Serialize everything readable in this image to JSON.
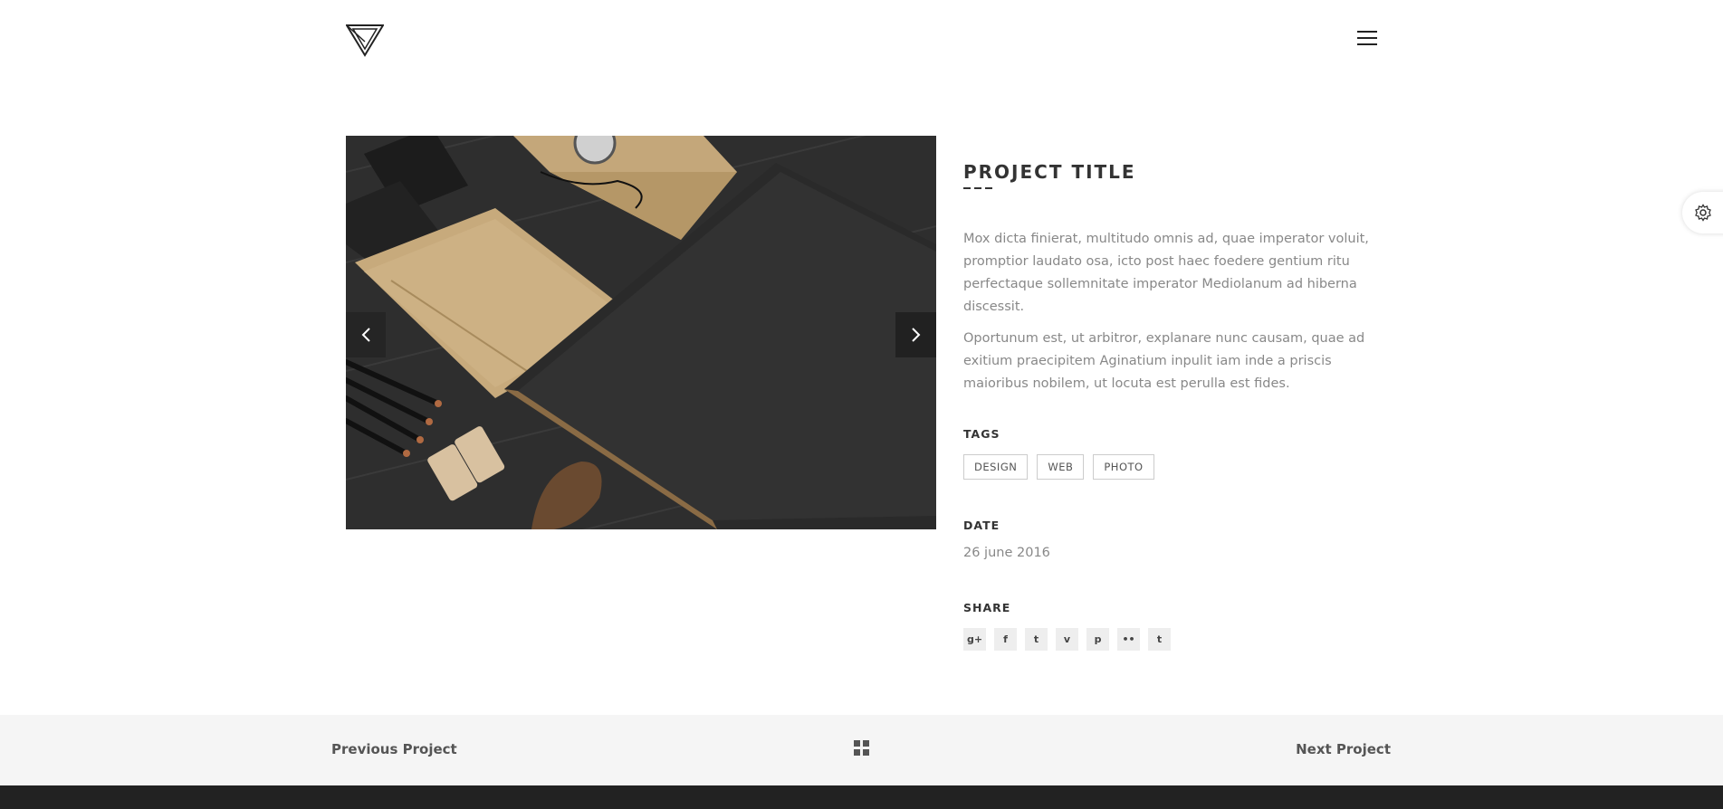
{
  "header": {
    "logo_icon": "triangle-logo",
    "menu_icon": "hamburger-menu-icon"
  },
  "slider": {
    "prev_icon": "chevron-left-icon",
    "next_icon": "chevron-right-icon"
  },
  "project": {
    "title": "PROJECT TITLE",
    "paragraph1": "Mox dicta finierat, multitudo omnis ad, quae imperator voluit, promptior laudato osa, icto post haec foedere gentium ritu perfectaque sollemnitate imperator Mediolanum ad hiberna discessit.",
    "paragraph2": "Oportunum est, ut arbitror, explanare nunc causam, quae ad exitium praecipitem Aginatium inpulit iam inde a priscis maioribus nobilem, ut locuta est perulla est fides.",
    "tags_label": "TAGS",
    "tags": [
      "DESIGN",
      "WEB",
      "PHOTO"
    ],
    "date_label": "DATE",
    "date": "26 june 2016",
    "share_label": "SHARE",
    "share_icons": [
      {
        "name": "google-plus-icon",
        "glyph": "g+"
      },
      {
        "name": "facebook-icon",
        "glyph": "f"
      },
      {
        "name": "twitter-icon",
        "glyph": "t"
      },
      {
        "name": "vimeo-icon",
        "glyph": "v"
      },
      {
        "name": "pinterest-icon",
        "glyph": "p"
      },
      {
        "name": "flickr-icon",
        "glyph": "••"
      },
      {
        "name": "tumblr-icon",
        "glyph": "t"
      }
    ]
  },
  "settings": {
    "icon": "gear-icon"
  },
  "project_nav": {
    "previous": "Previous Project",
    "next": "Next Project",
    "grid_icon": "grid-icon"
  },
  "colors": {
    "text_dark": "#333333",
    "text_muted": "#888888",
    "nav_bg": "#f5f5f5",
    "footer_bg": "#222222"
  }
}
